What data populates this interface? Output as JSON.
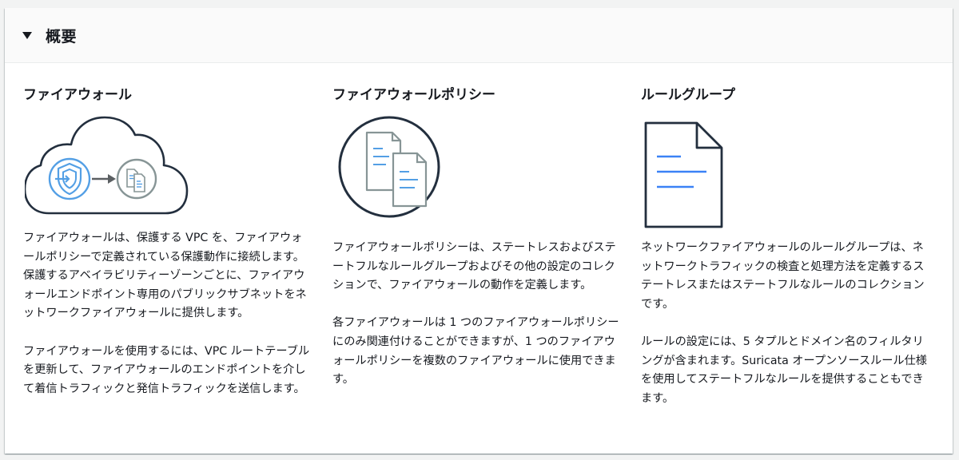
{
  "panel": {
    "title": "概要"
  },
  "columns": [
    {
      "title": "ファイアウォール",
      "icon": "firewall-cloud-icon",
      "paragraphs": [
        "ファイアウォールは、保護する VPC を、ファイアウォールポリシーで定義されている保護動作に接続します。保護するアベイラビリティーゾーンごとに、ファイアウォールエンドポイント専用のパブリックサブネットをネットワークファイアウォールに提供します。",
        "ファイアウォールを使用するには、VPC ルートテーブルを更新して、ファイアウォールのエンドポイントを介して着信トラフィックと発信トラフィックを送信します。"
      ]
    },
    {
      "title": "ファイアウォールポリシー",
      "icon": "policy-documents-icon",
      "paragraphs": [
        "ファイアウォールポリシーは、ステートレスおよびステートフルなルールグループおよびその他の設定のコレクションで、ファイアウォールの動作を定義します。",
        "各ファイアウォールは 1 つのファイアウォールポリシーにのみ関連付けることができますが、1 つのファイアウォールポリシーを複数のファイアウォールに使用できます。"
      ]
    },
    {
      "title": "ルールグループ",
      "icon": "document-icon",
      "paragraphs": [
        "ネットワークファイアウォールのルールグループは、ネットワークトラフィックの検査と処理方法を定義するステートレスまたはステートフルなルールのコレクションです。",
        "ルールの設定には、5 タプルとドメイン名のフィルタリングが含まれます。Suricata オープンソースルール仕様を使用してステートフルなルールを提供することもできます。"
      ]
    }
  ],
  "colors": {
    "accent_blue": "#539fe5",
    "icon_dark": "#232f3e",
    "icon_gray": "#879596",
    "line_blue": "#3b82f6"
  }
}
